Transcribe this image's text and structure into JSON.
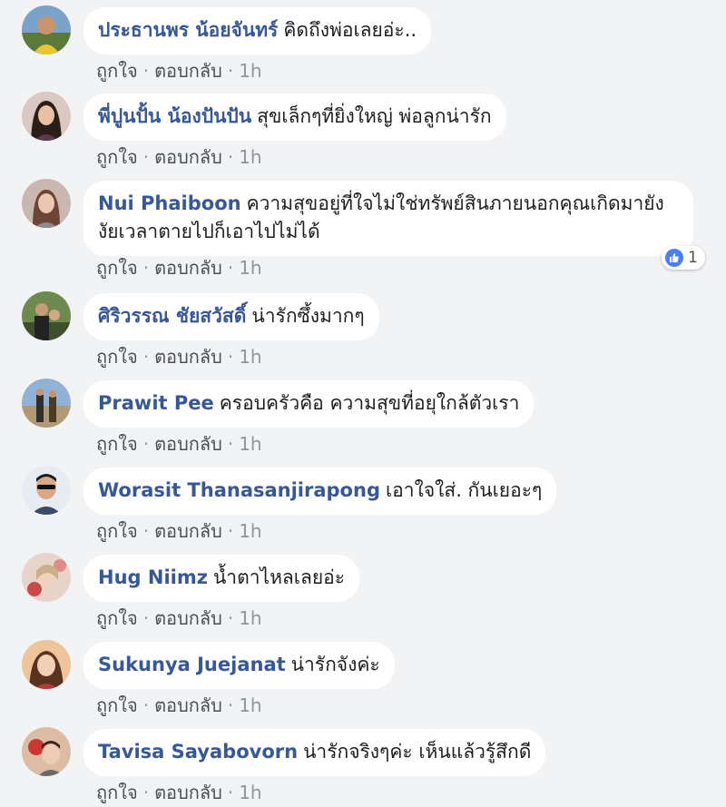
{
  "labels": {
    "like": "ถูกใจ",
    "reply": "ตอบกลับ",
    "separator": "·"
  },
  "comments": [
    {
      "name": "ประธานพร น้อยจันทร์",
      "text": "คิดถึงพ่อเลยอ่ะ..",
      "time": "1h"
    },
    {
      "name": "พี่ปูนปั้น น้องปันปัน",
      "text": "สุขเล็กๆที่ยิ่งใหญ่ พ่อลูกน่ารัก",
      "time": "1h"
    },
    {
      "name": "Nui Phaiboon",
      "text": "ความสุขอยู่ที่ใจไม่ใช่ทรัพย์สินภายนอกคุณเกิดมายังงัยเวลาตายไปก็เอาไปไม่ได้",
      "time": "1h",
      "reactions": "1"
    },
    {
      "name": "ศิริวรรณ ชัยสวัสดิ์",
      "text": "น่ารักซึ้งมากๆ",
      "time": "1h"
    },
    {
      "name": "Prawit Pee",
      "text": "ครอบครัวคือ ความสุขที่อยุใกล้ตัวเรา",
      "time": "1h"
    },
    {
      "name": "Worasit Thanasanjirapong",
      "text": "เอาใจใส่. กันเยอะๆ",
      "time": "1h"
    },
    {
      "name": "Hug Niimz",
      "text": "น้ำตาไหลเลยอ่ะ",
      "time": "1h"
    },
    {
      "name": "Sukunya Juejanat",
      "text": "น่ารักจังค่ะ",
      "time": "1h"
    },
    {
      "name": "Tavisa Sayabovorn",
      "text": "น่ารักจริงๆค่ะ เห็นแล้วรู้สึกดี",
      "time": "1h"
    }
  ],
  "colors": {
    "name": "#365899",
    "background": "#f2f3f5",
    "like_badge": "#4a7ffb"
  }
}
